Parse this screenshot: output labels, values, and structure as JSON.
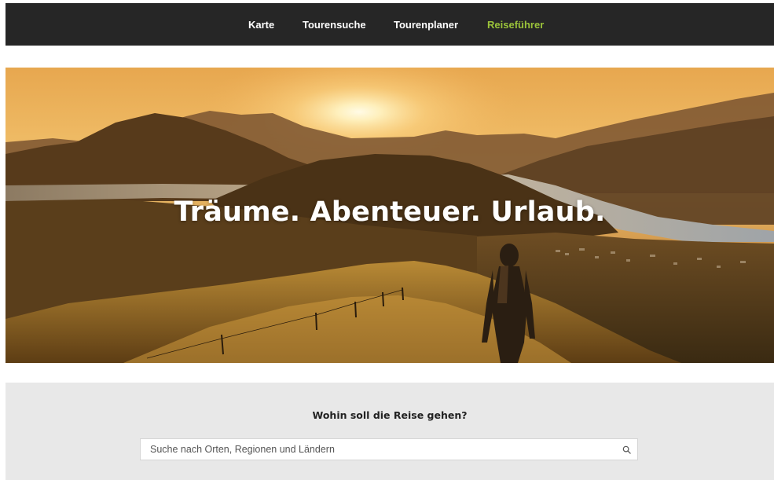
{
  "nav": {
    "items": [
      {
        "label": "Karte",
        "active": false
      },
      {
        "label": "Tourensuche",
        "active": false
      },
      {
        "label": "Tourenplaner",
        "active": false
      },
      {
        "label": "Reiseführer",
        "active": true
      }
    ],
    "background_color": "#262626",
    "active_color": "#9bc33a"
  },
  "hero": {
    "headline": "Träume. Abenteuer. Urlaub.",
    "image": "sunset-mountain-lake-hiker"
  },
  "search": {
    "heading": "Wohin soll die Reise gehen?",
    "placeholder": "Suche nach Orten, Regionen und Ländern",
    "value": "",
    "icon": "search-icon"
  }
}
